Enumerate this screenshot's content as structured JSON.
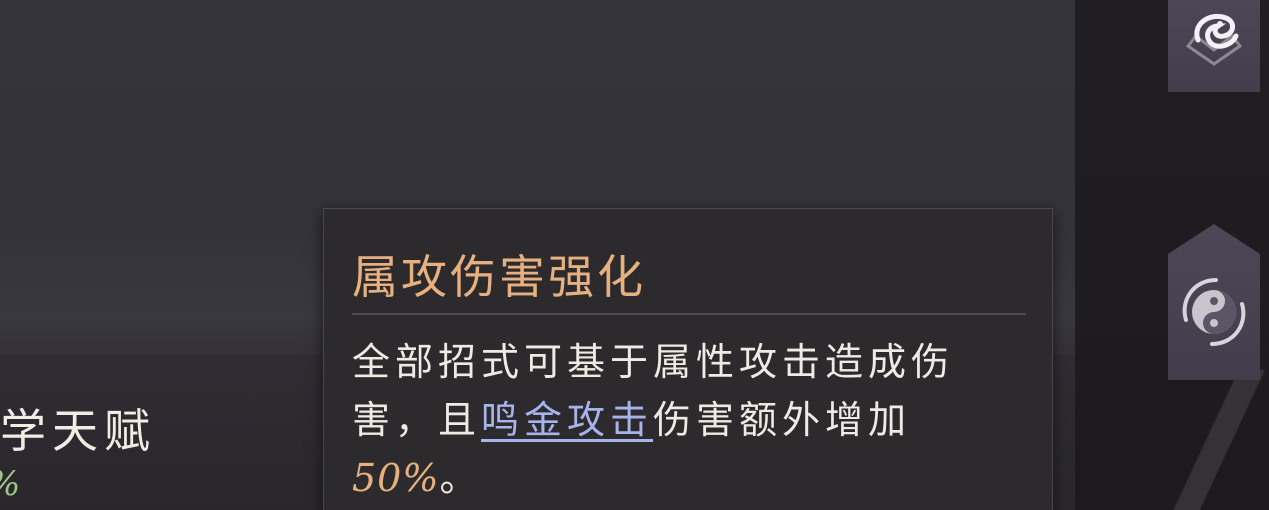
{
  "talent_panel": {
    "title": "学天赋",
    "percent_fragment": "%"
  },
  "tooltip": {
    "title": "属攻伤害强化",
    "desc_part1": "全部招式可基于属性攻击造成伤害，且",
    "desc_keyword": "鸣金攻击",
    "desc_part2": "伤害额外增加",
    "desc_value": "50%",
    "desc_end": "。"
  },
  "colors": {
    "title_accent": "#e7b07f",
    "keyword_link": "#a5b4ea",
    "percent_green": "#9fc58d"
  },
  "icons": {
    "top_skill": "water-swirl-icon",
    "bottom_skill": "yin-yang-icon"
  }
}
